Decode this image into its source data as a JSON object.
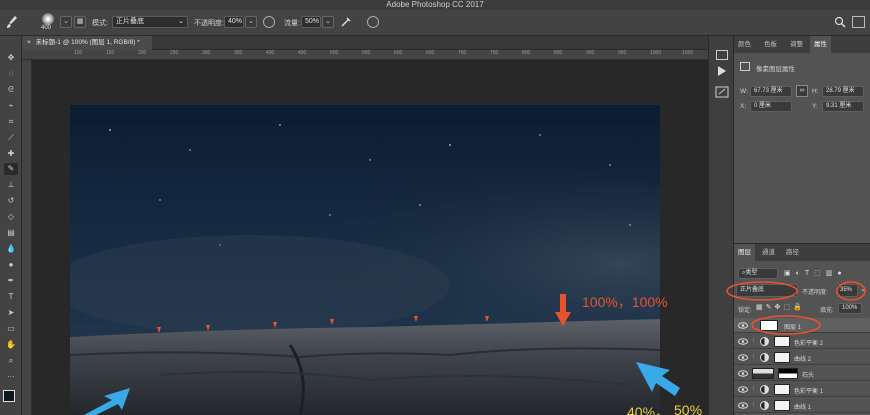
{
  "app": {
    "title": "Adobe Photoshop CC 2017"
  },
  "options_bar": {
    "brush_size": "400",
    "mode_label": "模式:",
    "mode_value": "正片叠底",
    "opacity_label": "不透明度:",
    "opacity_value": "40%",
    "flow_label": "流量:",
    "flow_value": "50%"
  },
  "document_tab": {
    "label": "未标题-1 @ 100% (图层 1, RGB/8) *"
  },
  "rulers": {
    "top_ticks": [
      "100",
      "150",
      "200",
      "250",
      "300",
      "350",
      "400",
      "450",
      "500",
      "550",
      "600",
      "650",
      "700",
      "750",
      "800",
      "850",
      "900",
      "950",
      "1000",
      "1050"
    ],
    "left_ticks": [
      "1",
      "5",
      "0",
      "1",
      "0",
      "0",
      "1",
      "5",
      "0",
      "2",
      "0",
      "0",
      "2",
      "5",
      "0",
      "3",
      "0",
      "0",
      "3",
      "5"
    ]
  },
  "toolbar": {
    "tools": [
      "move-tool",
      "marquee-tool",
      "lasso-tool",
      "quick-select-tool",
      "crop-tool",
      "eyedropper-tool",
      "healing-tool",
      "brush-tool",
      "stamp-tool",
      "history-brush-tool",
      "eraser-tool",
      "gradient-tool",
      "blur-tool",
      "dodge-tool",
      "pen-tool",
      "type-tool",
      "path-select-tool",
      "rectangle-tool",
      "hand-tool",
      "zoom-tool",
      "more-tools"
    ]
  },
  "properties_panel": {
    "tabs": [
      "颜色",
      "色板",
      "调整",
      "属性"
    ],
    "active_tab": "属性",
    "header": "像素图层属性",
    "w_label": "W:",
    "w_value": "67.73 厘米",
    "h_label": "H:",
    "h_value": "28.79 厘米",
    "x_label": "X:",
    "x_value": "0 厘米",
    "y_label": "Y:",
    "y_value": "9.31 厘米"
  },
  "layers_panel": {
    "tabs": [
      "图层",
      "通道",
      "路径"
    ],
    "active_tab": "图层",
    "filter_label": "类型",
    "blend_mode": "正片叠底",
    "opacity_label": "不透明度:",
    "opacity_value": "35%",
    "lock_label": "锁定:",
    "fill_label": "填充:",
    "fill_value": "100%",
    "layers": [
      {
        "name": "图层 1",
        "kind": "pixel"
      },
      {
        "name": "色彩平衡 2",
        "kind": "adjustment"
      },
      {
        "name": "曲线 2",
        "kind": "adjustment"
      },
      {
        "name": "石头",
        "kind": "mask"
      },
      {
        "name": "色彩平衡 1",
        "kind": "adjustment"
      },
      {
        "name": "曲线 1",
        "kind": "adjustment"
      }
    ]
  },
  "annotations": {
    "top_percent": "100%，100%",
    "bottom_left_percent": "40%，",
    "bottom_right_percent": "50%",
    "accent_color": "#e8532f",
    "arrow_blue": "#3aa9e8",
    "ellipse_color": "#e8532f"
  },
  "colors": {
    "sky_top": "#0d1e33",
    "sky_bottom": "#1f3550"
  }
}
